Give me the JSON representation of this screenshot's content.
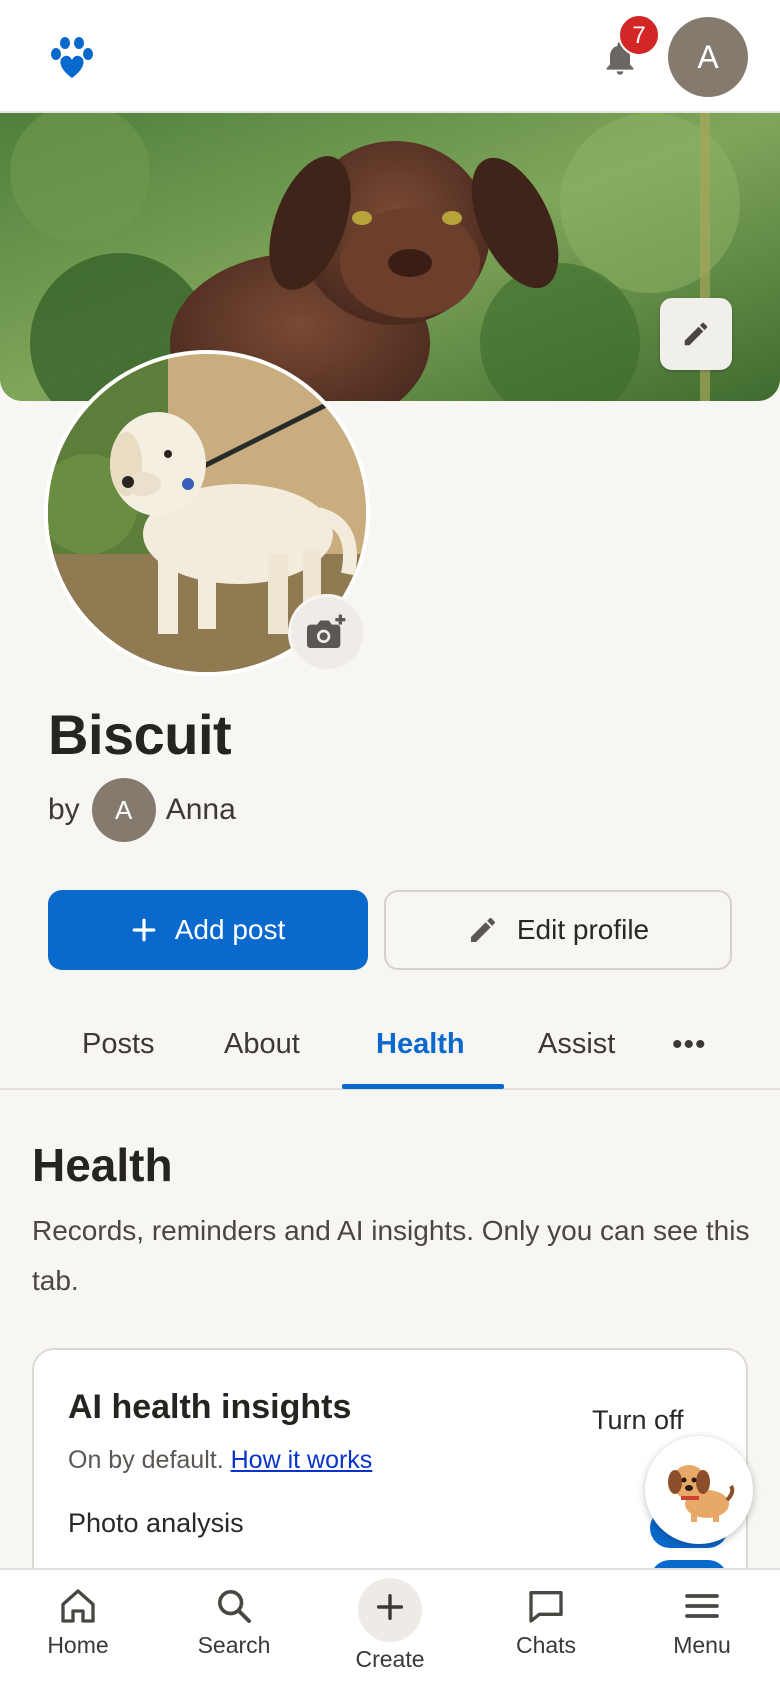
{
  "header": {
    "logo_icon": "paw-heart-icon",
    "notifications_count": "7",
    "user_initial": "A"
  },
  "pet": {
    "name": "Biscuit",
    "by_label": "by",
    "owner_initial": "A",
    "owner_name": "Anna"
  },
  "actions": {
    "add_post_label": "Add post",
    "edit_profile_label": "Edit profile"
  },
  "tabs": [
    {
      "label": "Posts",
      "active": false
    },
    {
      "label": "About",
      "active": false
    },
    {
      "label": "Health",
      "active": true
    },
    {
      "label": "Assist",
      "active": false
    }
  ],
  "tabs_more": "•••",
  "health": {
    "title": "Health",
    "description": "Records, reminders and AI insights. Only you can see this tab.",
    "card": {
      "title": "AI health insights",
      "subtitle": "On by default.",
      "link": "How it works",
      "turn_off": "Turn off",
      "photo_analysis": "Photo analysis"
    }
  },
  "bottom_nav": [
    {
      "label": "Home",
      "icon": "home-icon"
    },
    {
      "label": "Search",
      "icon": "search-icon"
    },
    {
      "label": "Create",
      "icon": "plus-icon"
    },
    {
      "label": "Chats",
      "icon": "chat-icon"
    },
    {
      "label": "Menu",
      "icon": "menu-icon"
    }
  ],
  "colors": {
    "accent": "#0a69cc",
    "badge": "#d32626",
    "avatar": "#857a6e"
  }
}
